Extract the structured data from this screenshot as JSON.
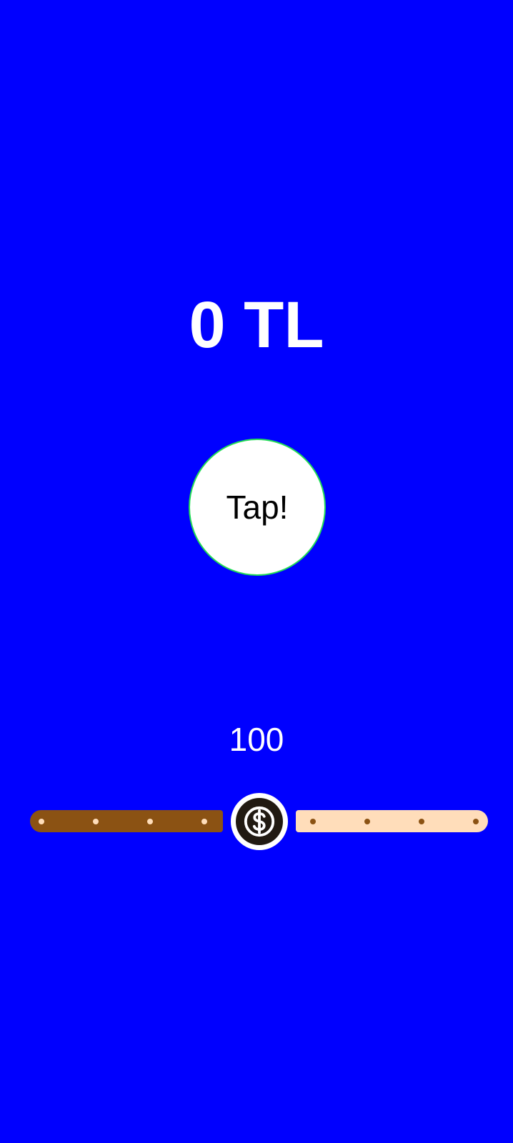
{
  "balance": {
    "amount_text": "0 TL"
  },
  "tap_button": {
    "label": "Tap!"
  },
  "slider": {
    "value_text": "100",
    "value": 100,
    "min": 0,
    "max": 200,
    "thumb_icon": "dollar-coin-icon",
    "colors": {
      "active_track": "#8B5213",
      "inactive_track": "#FFDDBA",
      "thumb": "#211A12"
    }
  },
  "colors": {
    "background": "#0000FF",
    "text": "#FFFFFF",
    "tap_border": "#22DD55"
  }
}
